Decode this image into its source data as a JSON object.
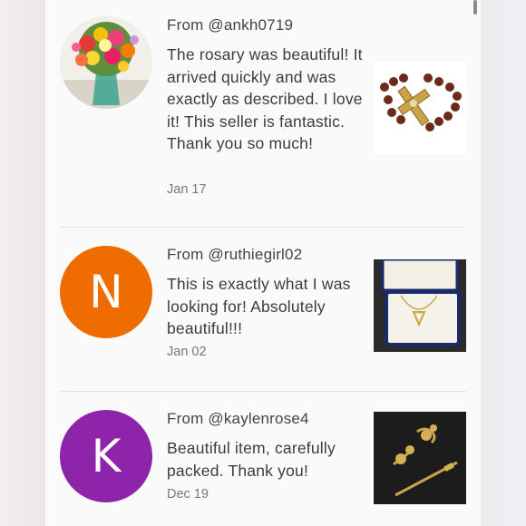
{
  "reviews": [
    {
      "from": "From @ankh0719",
      "text": "The rosary was beautiful! It arrived quickly and was exactly as described. I love it! This seller is fantastic. Thank you so much!",
      "date": "Jan 17",
      "avatar_type": "photo",
      "avatar_icon": "flower-bouquet-avatar",
      "thumb_icon": "rosary-thumbnail"
    },
    {
      "from": "From @ruthiegirl02",
      "text": "This is exactly what I was looking for! Absolutely beautiful!!!",
      "date": "Jan 02",
      "avatar_letter": "N",
      "avatar_color": "#ef6c00",
      "thumb_icon": "necklace-box-thumbnail"
    },
    {
      "from": "From @kaylenrose4",
      "text": "Beautiful item, carefully packed. Thank you!",
      "date": "Dec 19",
      "avatar_letter": "K",
      "avatar_color": "#8e24aa",
      "thumb_icon": "curtain-rod-finials-thumbnail"
    }
  ]
}
